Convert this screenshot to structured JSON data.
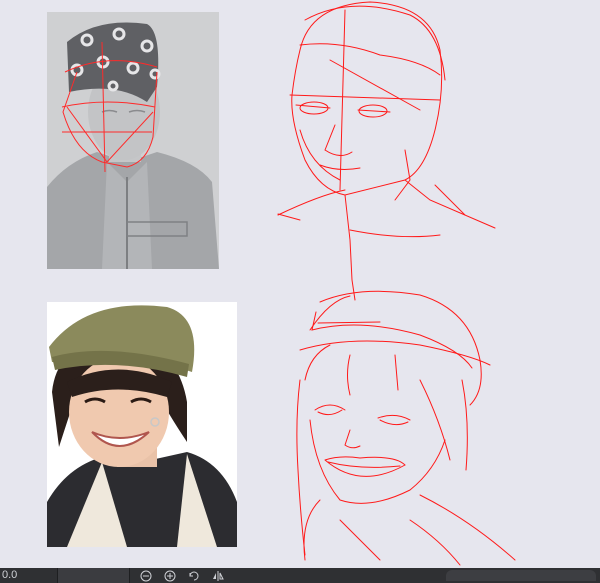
{
  "canvas": {
    "background": "#e6e6ee",
    "sketch_color": "#ff1a1a"
  },
  "reference_images": [
    {
      "name": "reference-photo-1",
      "desc_colors": [
        "#8f9093",
        "#cfd0d1"
      ]
    },
    {
      "name": "reference-photo-2",
      "desc_colors": [
        "#8a8a5e",
        "#2a2a2c"
      ]
    }
  ],
  "statusbar": {
    "zoom_value": "0.0",
    "icons": [
      "zoom-out-icon",
      "zoom-in-icon",
      "rotate-icon",
      "flip-icon"
    ]
  }
}
